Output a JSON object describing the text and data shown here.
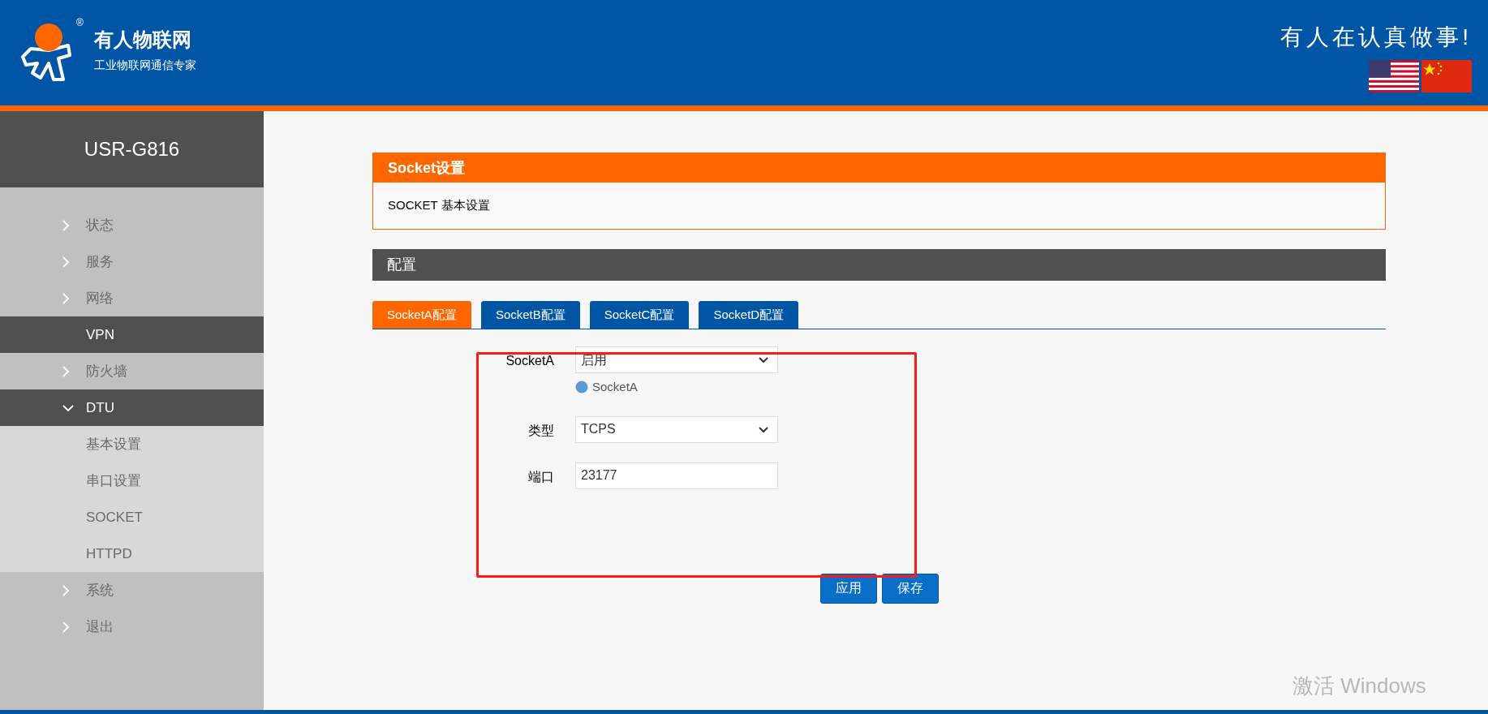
{
  "header": {
    "brand": "有人物联网",
    "tagline": "工业物联网通信专家",
    "slogan": "有人在认真做事!",
    "registered_mark": "®"
  },
  "sidebar": {
    "title": "USR-G816",
    "items": [
      {
        "label": "状态",
        "kind": "group",
        "expanded": false,
        "selected": false
      },
      {
        "label": "服务",
        "kind": "group",
        "expanded": false,
        "selected": false
      },
      {
        "label": "网络",
        "kind": "group",
        "expanded": false,
        "selected": false
      },
      {
        "label": "VPN",
        "kind": "link",
        "expanded": false,
        "selected": true
      },
      {
        "label": "防火墙",
        "kind": "group",
        "expanded": false,
        "selected": false
      },
      {
        "label": "DTU",
        "kind": "group",
        "expanded": true,
        "selected": true,
        "children": [
          {
            "label": "基本设置",
            "selected": false
          },
          {
            "label": "串口设置",
            "selected": false
          },
          {
            "label": "SOCKET",
            "selected": false
          },
          {
            "label": "HTTPD",
            "selected": false
          }
        ]
      },
      {
        "label": "系统",
        "kind": "group",
        "expanded": false,
        "selected": false
      },
      {
        "label": "退出",
        "kind": "group",
        "expanded": false,
        "selected": false
      }
    ]
  },
  "panel": {
    "title": "Socket设置",
    "description": "SOCKET 基本设置"
  },
  "section": {
    "title": "配置"
  },
  "tabs": [
    {
      "label": "SocketA配置",
      "selected": true
    },
    {
      "label": "SocketB配置",
      "selected": false
    },
    {
      "label": "SocketC配置",
      "selected": false
    },
    {
      "label": "SocketD配置",
      "selected": false
    }
  ],
  "form": {
    "fields": [
      {
        "label": "SocketA",
        "kind": "select",
        "value": "启用",
        "help": "SocketA"
      },
      {
        "label": "类型",
        "kind": "select",
        "value": "TCPS"
      },
      {
        "label": "端口",
        "kind": "input",
        "value": "23177"
      }
    ]
  },
  "buttons": [
    "应用",
    "保存"
  ],
  "os_notice": {
    "text": "激活 Windows"
  }
}
